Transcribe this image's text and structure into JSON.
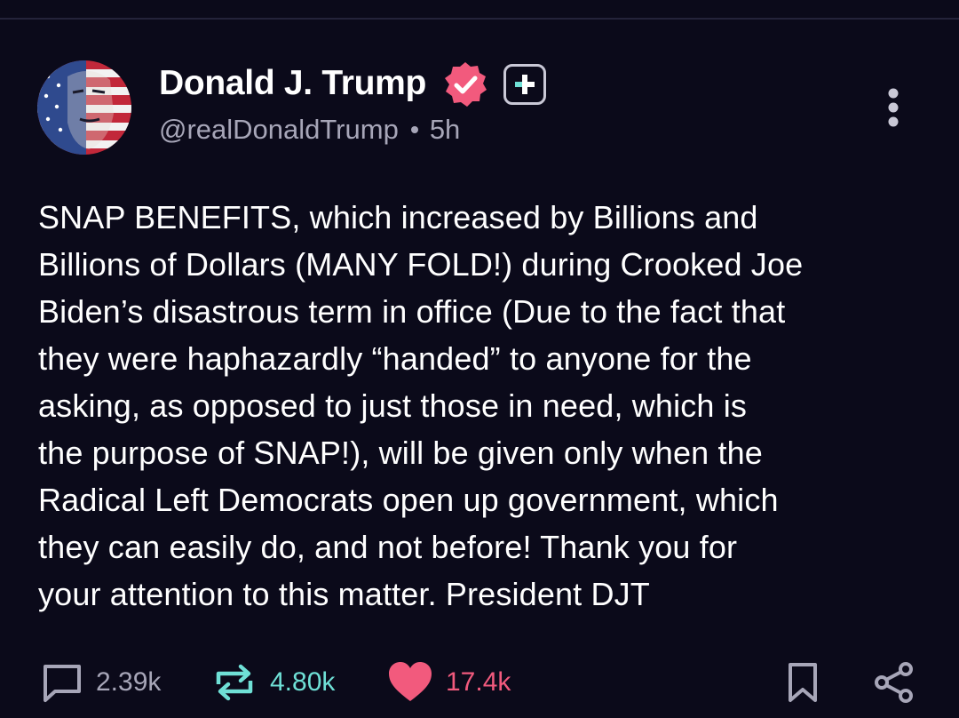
{
  "post": {
    "author": {
      "display_name": "Donald J. Trump",
      "handle": "@realDonaldTrump",
      "timestamp": "5h",
      "verified_icon": "verified-badge-icon",
      "plus_badge_icon": "plus-badge-icon"
    },
    "body": "SNAP BENEFITS, which increased by Billions and\nBillions of Dollars (MANY FOLD!) during Crooked Joe\nBiden’s disastrous term in office (Due to the fact that\nthey were haphazardly “handed” to anyone for the\nasking, as opposed to just those in need, which is\nthe purpose of SNAP!), will be given only when the\nRadical Left Democrats open up government, which\nthey can easily do, and not before! Thank you for\nyour attention to this matter. President DJT",
    "stats": {
      "replies": "2.39k",
      "reposts": "4.80k",
      "likes": "17.4k"
    }
  },
  "colors": {
    "background": "#0b0a1a",
    "verified": "#f25a7d",
    "repost": "#6fe0d6",
    "like": "#f25a7d",
    "muted": "#a7a6b8"
  }
}
